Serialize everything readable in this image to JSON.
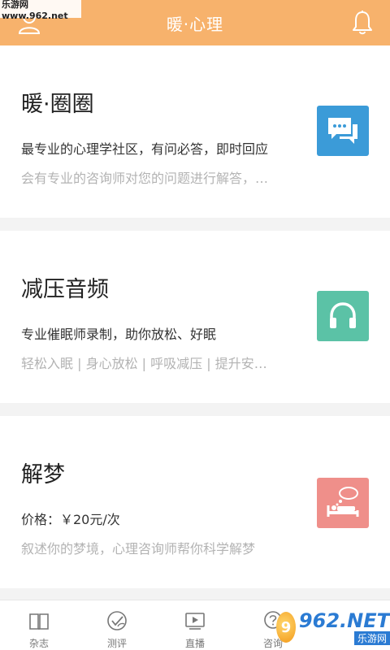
{
  "watermark_top": "乐游网 www.962.net",
  "header": {
    "title": "暖·心理",
    "left_icon": "user-icon",
    "right_icon": "bell-icon",
    "color": "#f7b26c"
  },
  "cards": [
    {
      "title": "暖·圈圈",
      "desc": "最专业的心理学社区，有问必答，即时回应",
      "sub": "会有专业的咨询师对您的问题进行解答，…",
      "icon": "chat-bubbles-icon",
      "icon_color": "#3b9bd8"
    },
    {
      "title": "减压音频",
      "desc": "专业催眠师录制，助你放松、好眠",
      "sub": "轻松入眠 | 身心放松 | 呼吸减压 | 提升安…",
      "icon": "headphones-icon",
      "icon_color": "#5bc2a6"
    },
    {
      "title": "解梦",
      "desc": "价格：￥20元/次",
      "sub": "叙述你的梦境，心理咨询师帮你科学解梦",
      "icon": "sleeping-bed-icon",
      "icon_color": "#ef8f8a"
    }
  ],
  "tabs": [
    {
      "label": "杂志",
      "icon": "book-icon"
    },
    {
      "label": "测评",
      "icon": "check-leaf-icon"
    },
    {
      "label": "直播",
      "icon": "video-play-icon"
    },
    {
      "label": "咨询",
      "icon": "question-bubble-icon"
    }
  ],
  "watermark_bottom": {
    "logo_text": "9",
    "brand": "962.NET",
    "sub": "乐游网"
  }
}
